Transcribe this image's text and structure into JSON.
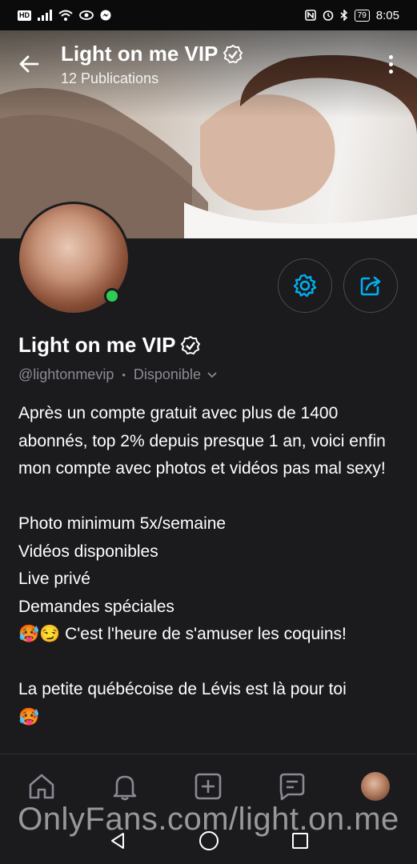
{
  "status_bar": {
    "time": "8:05",
    "battery": "79",
    "hd_badge": "HD",
    "icons_left": [
      "hd-icon",
      "signal-icon",
      "wifi-icon",
      "eye-icon",
      "messenger-icon"
    ],
    "icons_right": [
      "nfc-icon",
      "alarm-icon",
      "bluetooth-icon",
      "battery-icon"
    ]
  },
  "header": {
    "title": "Light on me VIP",
    "publications": "12 Publications"
  },
  "profile": {
    "name": "Light on me VIP",
    "handle": "@lightonmevip",
    "separator": "•",
    "availability": "Disponible",
    "online": true
  },
  "bio": {
    "text": "Après un compte gratuit avec plus de 1400 abonnés, top 2% depuis presque 1 an, voici enfin mon compte avec photos et vidéos pas mal sexy!\n\nPhoto minimum 5x/semaine\nVidéos disponibles\nLive privé\nDemandes spéciales\n🥵😏 C'est l'heure de s'amuser les coquins!\n\nLa petite québécoise de Lévis est là pour toi\n🥵"
  },
  "tabbar": {
    "items": [
      "home-icon",
      "bell-icon",
      "add-post-icon",
      "messages-icon",
      "profile-avatar"
    ]
  },
  "watermark": "OnlyFans.com/light.on.me",
  "colors": {
    "accent": "#00aff0",
    "online": "#2ecc52",
    "background": "#1b1b1e"
  }
}
